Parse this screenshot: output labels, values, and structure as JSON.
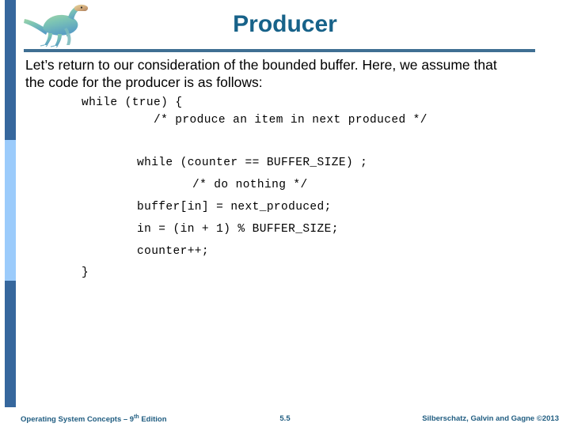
{
  "slide": {
    "title": "Producer",
    "body_paragraph": "Let’s return to our consideration of the bounded buffer.  Here, we assume that the code for the producer is as follows:",
    "code_lines": [
      "while (true) {",
      "/* produce an item in next produced */",
      "while (counter == BUFFER_SIZE) ;",
      "/* do nothing */",
      "buffer[in] = next_produced;",
      "in = (in + 1) % BUFFER_SIZE;",
      "counter++;",
      "}"
    ]
  },
  "footer": {
    "left_text": "Operating System Concepts – 9",
    "left_sup": "th",
    "left_suffix": " Edition",
    "page_number": "5.5",
    "right_text": "Silberschatz, Galvin and Gagne ©2013"
  },
  "logo": {
    "name": "dinosaur-mascot"
  },
  "colors": {
    "title": "#176289",
    "rule": "#3f6f93",
    "sidebar_dark": "#36679d",
    "sidebar_light": "#9bcbfb",
    "footer_text": "#1f5c80",
    "body_text": "#000000"
  }
}
